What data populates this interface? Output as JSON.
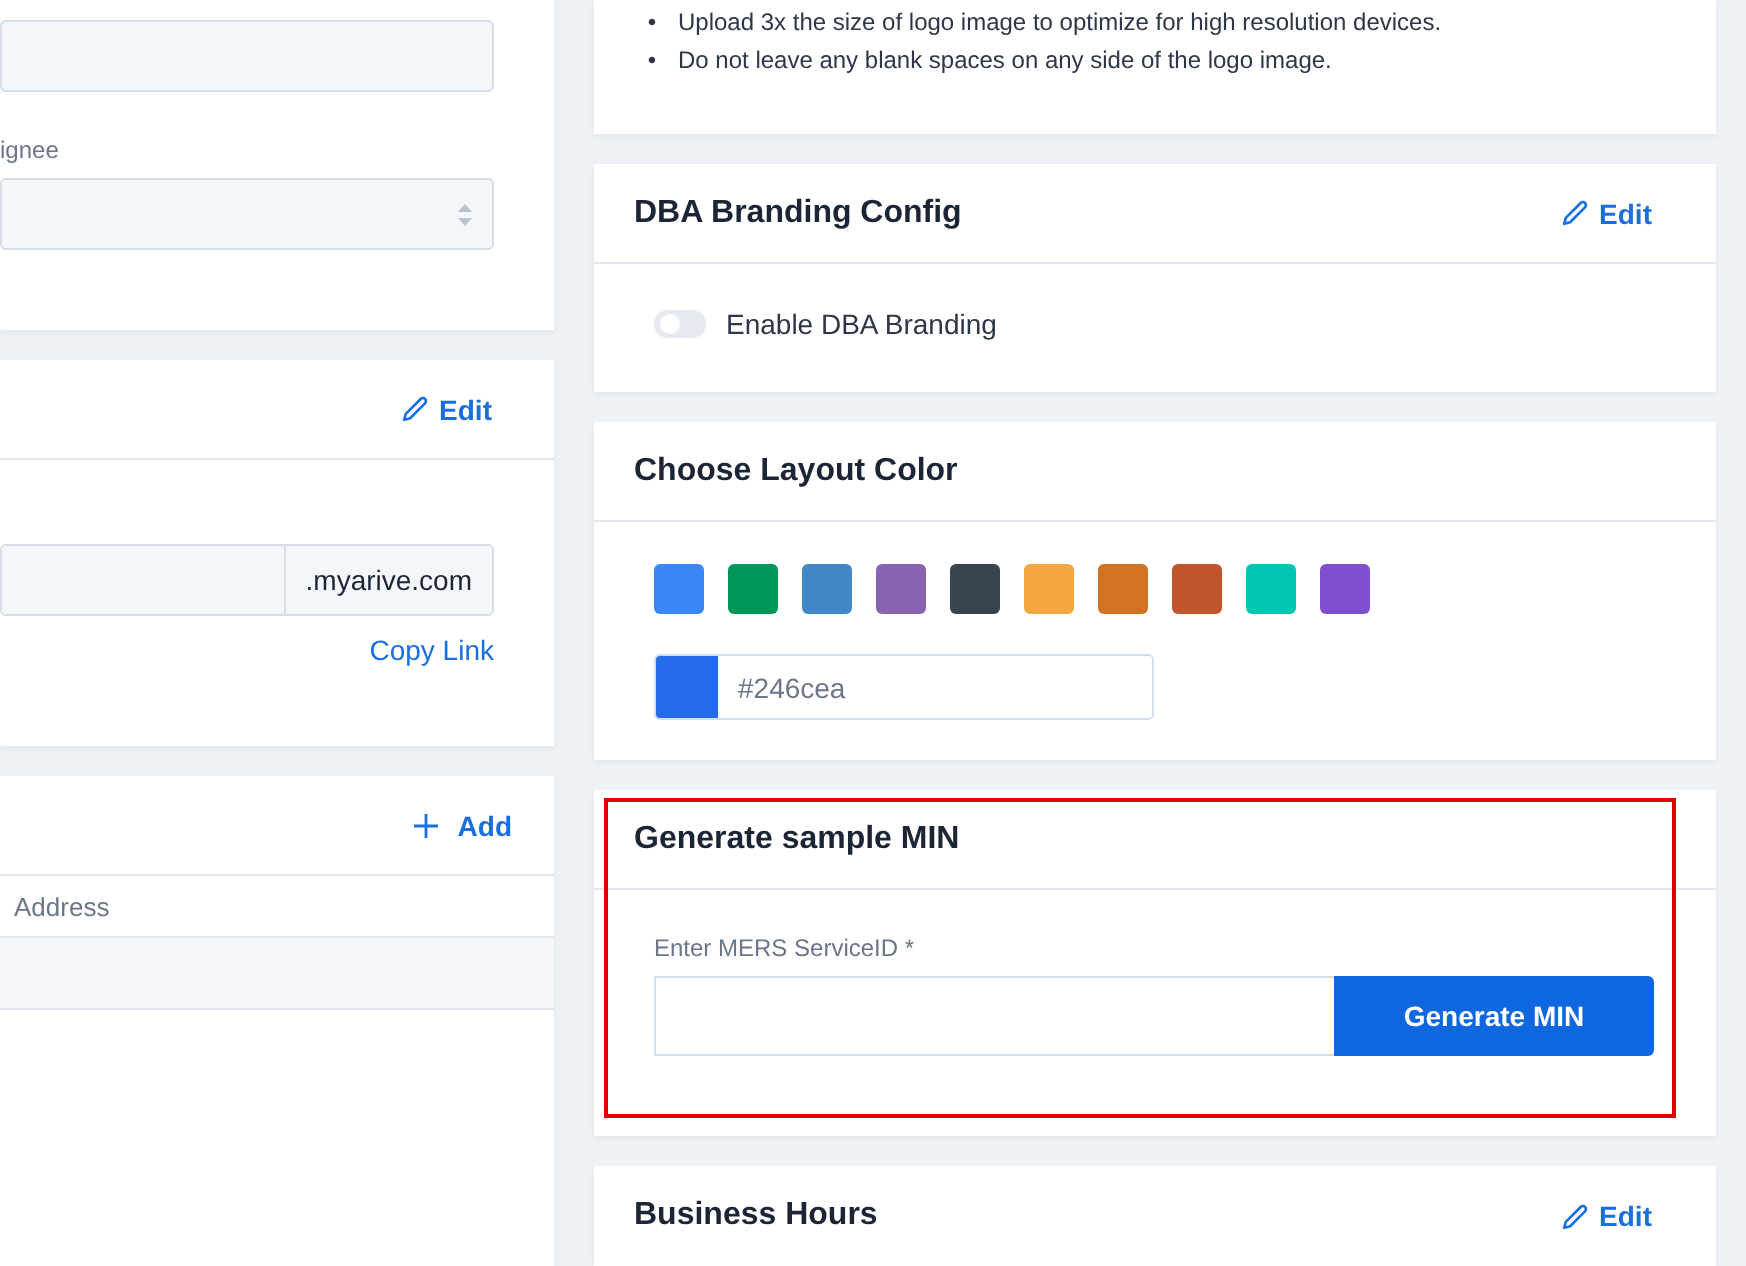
{
  "left_column": {
    "assignment_card": {
      "assignee_label": "ignee"
    },
    "domain_card": {
      "edit_link": "Edit",
      "subdomain_field": {
        "suffix": ".myarive.com"
      },
      "copy_link": "Copy Link"
    },
    "address_card": {
      "add_link": "Add",
      "table": {
        "columns": [
          "Address"
        ],
        "rows": [
          {
            "address": ""
          }
        ]
      }
    }
  },
  "right_column": {
    "logo_card": {
      "bullets": [
        {
          "marker": "•",
          "text": "Upload 3x the size of logo image to optimize for high resolution devices."
        },
        {
          "marker": "•",
          "text": "Do not leave any blank spaces on any side of the logo image."
        }
      ]
    },
    "dba_card": {
      "title": "DBA Branding Config",
      "edit_link": "Edit",
      "toggle": {
        "label": "Enable DBA Branding",
        "on": false
      }
    },
    "color_card": {
      "title": "Choose Layout Color",
      "swatches": [
        {
          "color": "#3b86f7"
        },
        {
          "color": "#02975a"
        },
        {
          "color": "#4287c5"
        },
        {
          "color": "#8763b0"
        },
        {
          "color": "#394451"
        },
        {
          "color": "#f3a641"
        },
        {
          "color": "#d27323"
        },
        {
          "color": "#c2552f"
        },
        {
          "color": "#00c6b4"
        },
        {
          "color": "#7f4fcf"
        }
      ],
      "color_field": {
        "value": "#246cea",
        "color": "#246cea"
      }
    },
    "min_card": {
      "title": "Generate sample MIN",
      "highlighted": true,
      "field_label": "Enter MERS ServiceID *",
      "button": "Generate MIN"
    },
    "hours_card": {
      "title": "Business Hours",
      "edit_link": "Edit"
    }
  }
}
